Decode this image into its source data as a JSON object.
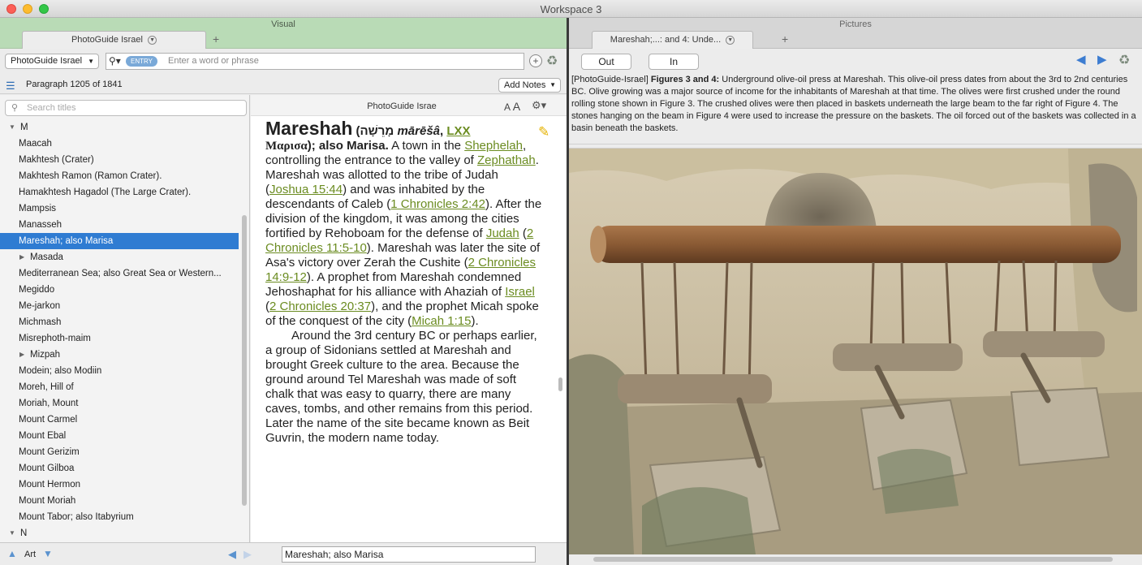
{
  "window": {
    "title": "Workspace 3"
  },
  "left_panel": {
    "label": "Visual",
    "tab": "PhotoGuide Israel",
    "resource_select": "PhotoGuide Israel",
    "search": {
      "pill": "ENTRY",
      "placeholder": "Enter a word or phrase"
    },
    "paragraph_info": "Paragraph 1205 of 1841",
    "add_notes": "Add Notes",
    "titles_search_placeholder": "Search titles",
    "titles": [
      {
        "label": "M",
        "kind": "group",
        "expanded": true
      },
      {
        "label": "Maacah"
      },
      {
        "label": "Makhtesh (Crater)"
      },
      {
        "label": "Makhtesh Ramon (Ramon Crater)."
      },
      {
        "label": "Hamakhtesh Hagadol (The Large Crater)."
      },
      {
        "label": "Mampsis"
      },
      {
        "label": "Manasseh"
      },
      {
        "label": "Mareshah; also Marisa",
        "selected": true
      },
      {
        "label": "Masada",
        "kind": "sub"
      },
      {
        "label": "Mediterranean Sea; also Great Sea or Western..."
      },
      {
        "label": "Megiddo"
      },
      {
        "label": "Me-jarkon"
      },
      {
        "label": "Michmash"
      },
      {
        "label": "Misrephoth-maim"
      },
      {
        "label": "Mizpah",
        "kind": "sub"
      },
      {
        "label": "Modein; also Modiin"
      },
      {
        "label": "Moreh, Hill of"
      },
      {
        "label": "Moriah, Mount"
      },
      {
        "label": "Mount Carmel"
      },
      {
        "label": "Mount Ebal"
      },
      {
        "label": "Mount Gerizim"
      },
      {
        "label": "Mount Gilboa"
      },
      {
        "label": "Mount Hermon"
      },
      {
        "label": "Mount Moriah"
      },
      {
        "label": "Mount Tabor; also Itabyrium"
      },
      {
        "label": "N",
        "kind": "group",
        "expanded": true
      }
    ],
    "reader": {
      "header": "PhotoGuide Israe",
      "font_small": "A",
      "font_large": "A",
      "article": {
        "headword": "Mareshah",
        "hebrew": " (מָרֵשָׁה ",
        "translit": "mārēšâ",
        "sep": ", ",
        "lxx": "LXX",
        "greek": "Μαρισα",
        "also": "); also Marisa.",
        "t1": " A town in the ",
        "l_shephelah": "Shephelah",
        "t2": ", controlling the entrance to the valley of ",
        "l_zephathah": "Zephathah",
        "t3": ". Mareshah was allotted to the tribe of Judah (",
        "l_joshua": "Joshua 15:44",
        "t4": ") and was inhabited by the descendants of Caleb (",
        "l_1chr242": "1 Chronicles 2:42",
        "t5": "). After the division of the kingdom, it was among the cities fortified by Rehoboam for the defense of ",
        "l_judah": "Judah",
        "t6": " (",
        "l_2chr115": "2 Chronicles 11:5-10",
        "t7": "). Mareshah was later the site of Asa's victory over Zerah the Cushite (",
        "l_2chr149": "2 Chronicles 14:9-12",
        "t8": "). A prophet from Mareshah condemned Jehoshaphat for his alliance with Ahaziah of ",
        "l_israel": "Israel",
        "t9": " (",
        "l_2chr2037": "2 Chronicles 20:37",
        "t10": "), and the prophet Micah spoke of the conquest of the city (",
        "l_micah": "Micah 1:15",
        "t11": ").",
        "para2": "Around the 3rd century BC or perhaps earlier, a group of Sidonians settled at Mareshah and brought Greek culture to the area. Because the ground around Tel Mareshah was made of soft chalk that was easy to quarry, there are many caves, tombs, and other remains from this period. Later the name of the site became known as Beit Guvrin, the modern name today."
      }
    },
    "footer": {
      "art_label": "Art",
      "current_title": "Mareshah; also Marisa"
    }
  },
  "right_panel": {
    "label": "Pictures",
    "tab": "Mareshah;...: and 4: Unde...",
    "out_label": "Out",
    "in_label": "In",
    "caption": {
      "prefix": "[PhotoGuide-Israel] ",
      "bold": "Figures 3 and 4:",
      "text": " Underground olive-oil press at Mareshah. This olive-oil press dates from about the 3rd to 2nd centuries BC. Olive growing was a major source of income for the inhabitants of Mareshah at that time. The olives were first crushed under the round rolling stone shown in Figure 3. The crushed olives were then placed in baskets underneath the large beam to the far right of Figure 4. The stones hanging on the beam in Figure 4 were used to increase the pressure on the baskets. The oil forced out of the baskets was collected in a basin beneath the baskets."
    }
  },
  "colors": {
    "visual_tab_bg": "#b9dbb6",
    "selection": "#2f7cd2",
    "link": "#6b8c21",
    "nav_blue": "#3d7dd1"
  },
  "icons": [
    "search-icon",
    "plus-icon",
    "recycle-icon",
    "list-icon",
    "gear-icon",
    "pencil-icon",
    "arrow-left-icon",
    "arrow-right-icon",
    "triangle-up-icon",
    "triangle-down-icon",
    "disclosure-triangle-icon"
  ]
}
